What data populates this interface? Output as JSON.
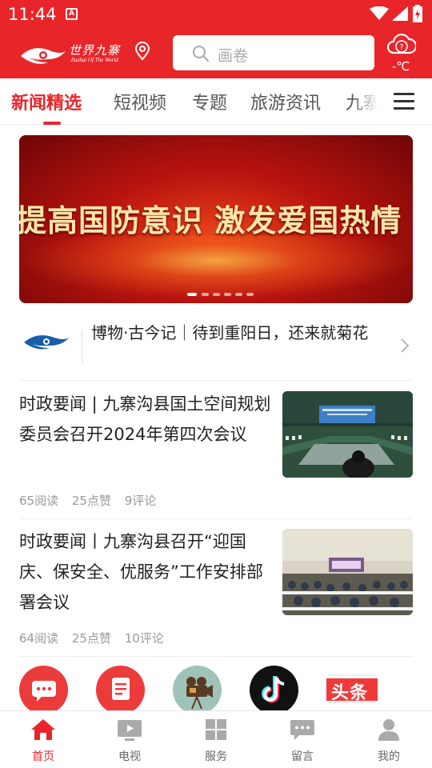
{
  "status_bar": {
    "time": "11:44"
  },
  "header": {
    "logo_text": "世界九寨",
    "logo_subtitle": "Jiuzhai Of The World",
    "search_placeholder": "画卷",
    "weather_temp": "-℃"
  },
  "tabs": [
    {
      "label": "新闻精选",
      "active": true
    },
    {
      "label": "短视频"
    },
    {
      "label": "专题"
    },
    {
      "label": "旅游资讯"
    },
    {
      "label": "九寨"
    }
  ],
  "banner": {
    "text": "提高国防意识 激发爱国热情",
    "slide_count": 6,
    "active_slide": 1
  },
  "feature": {
    "text": "博物·古今记｜待到重阳日，还来就菊花"
  },
  "news": [
    {
      "title": "时政要闻 | 九寨沟县国土空间规划委员会召开2024年第四次会议",
      "reads": "65阅读",
      "likes": "25点赞",
      "comments": "9评论"
    },
    {
      "title": "时政要闻丨九寨沟县召开“迎国庆、保安全、优服务”工作安排部署会议",
      "reads": "64阅读",
      "likes": "25点赞",
      "comments": "10评论"
    }
  ],
  "apps": {
    "toutiao_label": "头条"
  },
  "bottom_nav": [
    {
      "label": "首页",
      "icon": "home-icon",
      "active": true
    },
    {
      "label": "电视",
      "icon": "tv-icon"
    },
    {
      "label": "服务",
      "icon": "grid-icon"
    },
    {
      "label": "留言",
      "icon": "message-icon"
    },
    {
      "label": "我的",
      "icon": "user-icon"
    }
  ],
  "colors": {
    "brand_red": "#e8262a"
  }
}
